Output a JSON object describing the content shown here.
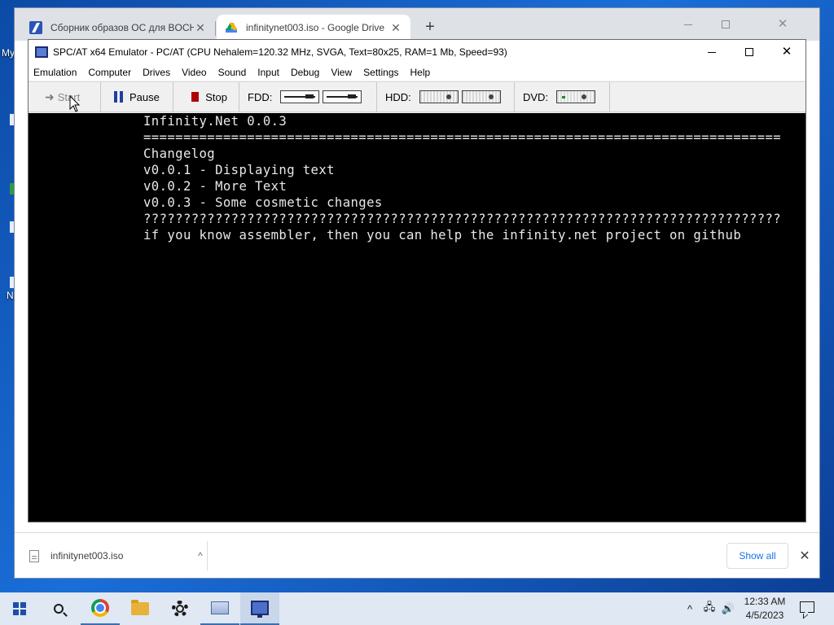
{
  "desktop": {
    "edge_labels": [
      "My",
      "N"
    ]
  },
  "browser": {
    "tabs": [
      {
        "title": "Сборник образов ОС для BOCHS",
        "icon": "generic-site-icon",
        "close": "✕",
        "active": false
      },
      {
        "title": "infinitynet003.iso - Google Drive",
        "icon": "google-drive-icon",
        "close": "✕",
        "active": true
      }
    ],
    "new_tab": "+",
    "controls": {
      "minimize": "—",
      "maximize": "☐",
      "close": "✕"
    }
  },
  "emulator": {
    "title": "SPC/AT x64 Emulator - PC/AT (CPU Nehalem=120.32 MHz, SVGA, Text=80x25, RAM=1 Mb, Speed=93)",
    "controls": {
      "minimize": "—",
      "maximize": "☐",
      "close": "✕"
    },
    "menu": [
      "Emulation",
      "Computer",
      "Drives",
      "Video",
      "Sound",
      "Input",
      "Debug",
      "View",
      "Settings",
      "Help"
    ],
    "toolbar": {
      "start": "Start",
      "pause": "Pause",
      "stop": "Stop",
      "fdd": "FDD:",
      "hdd": "HDD:",
      "dvd": "DVD:"
    },
    "screen_lines": [
      "Infinity.Net 0.0.3",
      "================================================================================",
      "Changelog",
      "v0.0.1 - Displaying text",
      "v0.0.2 - More Text",
      "v0.0.3 - Some cosmetic changes",
      "????????????????????????????????????????????????????????????????????????????????",
      "if you know assembler, then you can help the infinity.net project on github"
    ]
  },
  "downloads": {
    "file_name": "infinitynet003.iso",
    "chevron": "^",
    "show_all": "Show all",
    "close": "✕"
  },
  "taskbar": {
    "apps": [
      "start-icon",
      "search-icon",
      "chrome-icon",
      "file-explorer-icon",
      "settings-gear-icon",
      "image-gallery-icon",
      "emulator-icon"
    ],
    "tray": {
      "chevron": "^",
      "network": "🖧",
      "volume": "🔊"
    },
    "time": "12:33 AM",
    "date": "4/5/2023"
  }
}
